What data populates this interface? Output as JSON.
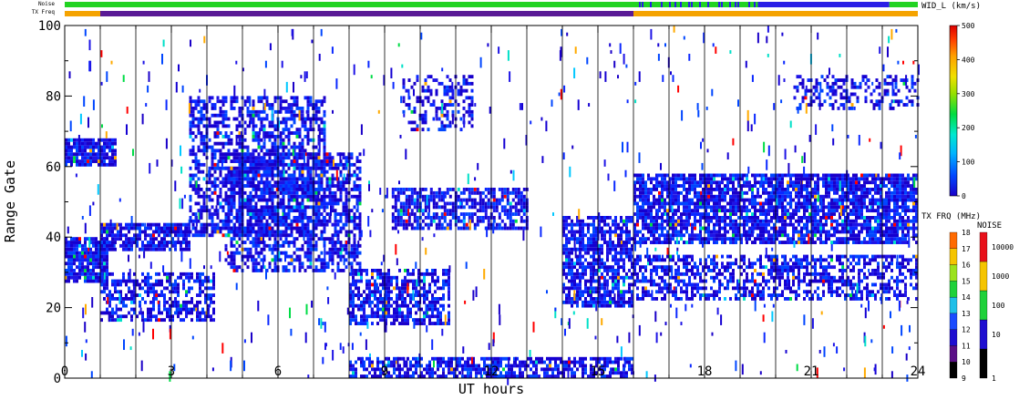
{
  "chart_data": {
    "type": "heatmap",
    "xlabel": "UT hours",
    "ylabel": "Range Gate",
    "xlim": [
      0,
      24
    ],
    "ylim": [
      0,
      100
    ],
    "xticks": [
      0,
      3,
      6,
      9,
      12,
      15,
      18,
      21,
      24
    ],
    "yticks": [
      0,
      20,
      40,
      60,
      80,
      100
    ],
    "grid": "vertical lines every hour",
    "status_bars": [
      {
        "name": "Noise",
        "segments": [
          {
            "from": 0,
            "to": 16,
            "level": "green"
          },
          {
            "from": 16,
            "to": 19.5,
            "level": "green-blue mix"
          },
          {
            "from": 19.5,
            "to": 23.2,
            "level": "blue"
          },
          {
            "from": 23.2,
            "to": 24,
            "level": "green"
          }
        ]
      },
      {
        "name": "TX Freq",
        "segments": [
          {
            "from": 0,
            "to": 1,
            "mhz": 15
          },
          {
            "from": 1,
            "to": 16,
            "mhz": 10
          },
          {
            "from": 16,
            "to": 24,
            "mhz": 15
          }
        ]
      }
    ],
    "main_colorbar": {
      "title": "WID_L (km/s)",
      "range": [
        0,
        500
      ],
      "ticks": [
        0,
        100,
        200,
        300,
        400,
        500
      ]
    },
    "freq_colorbar": {
      "title": "TX FRQ (MHz)",
      "ticks": [
        9,
        10,
        11,
        12,
        13,
        14,
        15,
        16,
        17,
        18
      ],
      "colors": [
        "#000000",
        "#5a0f86",
        "#1e0ed0",
        "#1a4bff",
        "#1fbfe8",
        "#1fd13a",
        "#9be21c",
        "#f5c400",
        "#ff6a00",
        "#e8101a"
      ]
    },
    "noise_colorbar": {
      "title": "NOISE",
      "ticks": [
        "1",
        "10",
        "100",
        "1000",
        "10000"
      ],
      "colors": [
        "#000000",
        "#1e0ed0",
        "#1fd13a",
        "#f5c400",
        "#e8101a"
      ]
    },
    "scatter_regions": [
      {
        "gate_start": 60,
        "gate_end": 68,
        "x_start": 0,
        "x_end": 1.4,
        "density": 0.85
      },
      {
        "gate_start": 27,
        "gate_end": 40,
        "x_start": 0,
        "x_end": 1.2,
        "density": 0.9
      },
      {
        "gate_start": 16,
        "gate_end": 30,
        "x_start": 1,
        "x_end": 4.2,
        "density": 0.55
      },
      {
        "gate_start": 36,
        "gate_end": 44,
        "x_start": 1,
        "x_end": 3.5,
        "density": 0.8
      },
      {
        "gate_start": 40,
        "gate_end": 80,
        "x_start": 3.5,
        "x_end": 7.3,
        "density": 0.55
      },
      {
        "gate_start": 30,
        "gate_end": 64,
        "x_start": 4.5,
        "x_end": 8.3,
        "density": 0.6
      },
      {
        "gate_start": 15,
        "gate_end": 31,
        "x_start": 8,
        "x_end": 10.8,
        "density": 0.65
      },
      {
        "gate_start": 42,
        "gate_end": 54,
        "x_start": 9.2,
        "x_end": 13,
        "density": 0.7
      },
      {
        "gate_start": 70,
        "gate_end": 86,
        "x_start": 9.5,
        "x_end": 11.5,
        "density": 0.35
      },
      {
        "gate_start": 0,
        "gate_end": 6,
        "x_start": 8,
        "x_end": 16,
        "density": 0.65
      },
      {
        "gate_start": 20,
        "gate_end": 46,
        "x_start": 14,
        "x_end": 16,
        "density": 0.7
      },
      {
        "gate_start": 38,
        "gate_end": 58,
        "x_start": 16,
        "x_end": 24,
        "density": 0.8
      },
      {
        "gate_start": 22,
        "gate_end": 35,
        "x_start": 16,
        "x_end": 24,
        "density": 0.55
      },
      {
        "gate_start": 76,
        "gate_end": 86,
        "x_start": 20.5,
        "x_end": 24,
        "density": 0.35
      }
    ]
  },
  "labels": {
    "noise_row": "Noise",
    "tx_row": "TX Freq"
  }
}
